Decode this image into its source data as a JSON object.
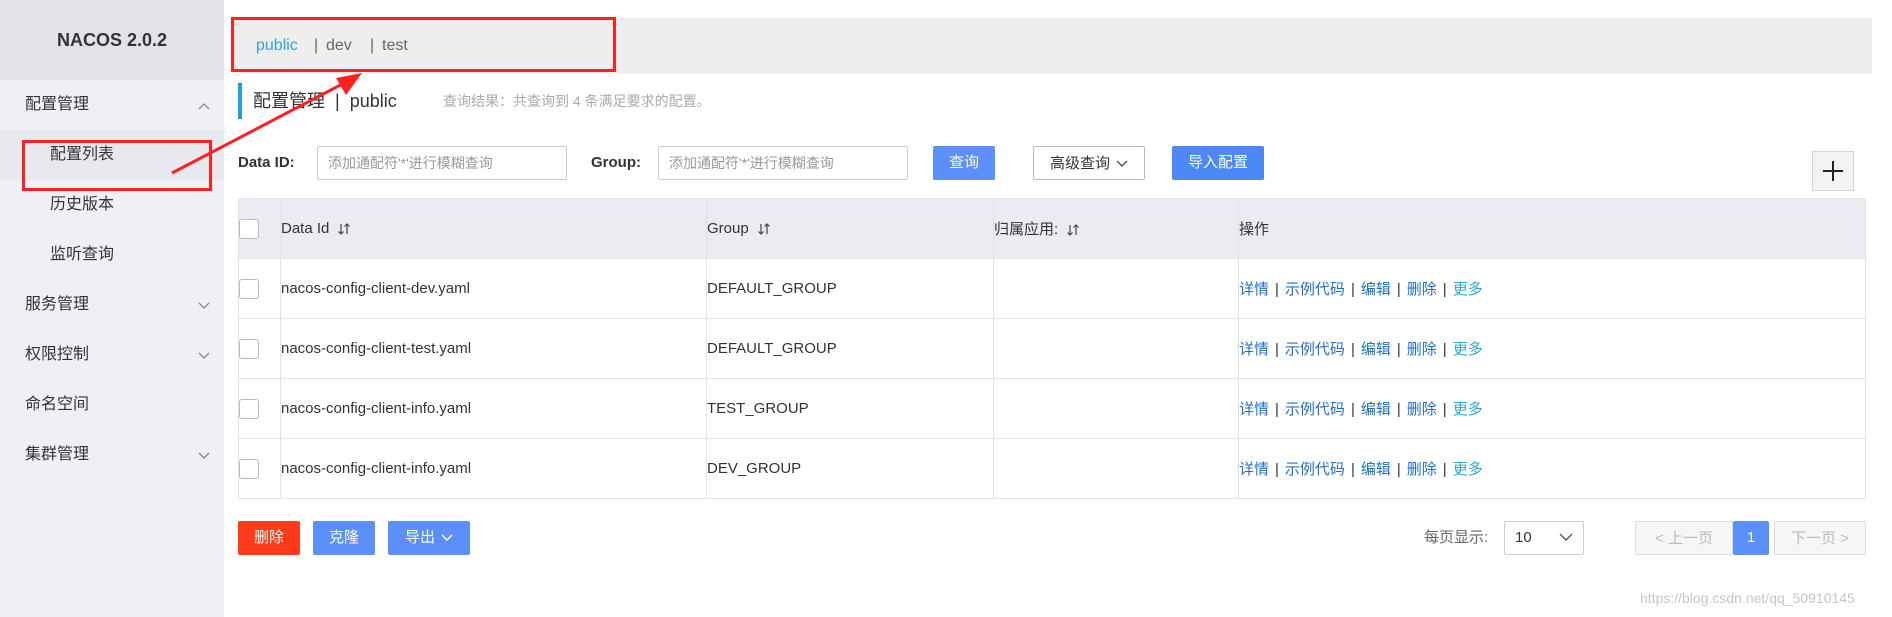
{
  "app": {
    "brand": "NACOS 2.0.2"
  },
  "sidebar": {
    "items": [
      {
        "label": "配置管理",
        "icon": "chevron-up-icon"
      },
      {
        "label": "配置列表"
      },
      {
        "label": "历史版本"
      },
      {
        "label": "监听查询"
      },
      {
        "label": "服务管理",
        "icon": "chevron-down-icon"
      },
      {
        "label": "权限控制",
        "icon": "chevron-down-icon"
      },
      {
        "label": "命名空间"
      },
      {
        "label": "集群管理",
        "icon": "chevron-down-icon"
      }
    ]
  },
  "namespaces": {
    "items": [
      "public",
      "dev",
      "test"
    ],
    "separator": "|"
  },
  "header": {
    "title": "配置管理",
    "separator": "|",
    "namespace": "public",
    "result_text": "查询结果：共查询到 4 条满足要求的配置。"
  },
  "search": {
    "data_id_label": "Data ID:",
    "data_id_placeholder": "添加通配符'*'进行模糊查询",
    "group_label": "Group:",
    "group_placeholder": "添加通配符'*'进行模糊查询",
    "query_label": "查询",
    "advanced_label": "高级查询",
    "import_label": "导入配置",
    "add_icon": "plus-icon"
  },
  "table": {
    "columns": [
      "Data Id",
      "Group",
      "归属应用:",
      "操作"
    ],
    "rows": [
      {
        "data_id": "nacos-config-client-dev.yaml",
        "group": "DEFAULT_GROUP",
        "app": ""
      },
      {
        "data_id": "nacos-config-client-test.yaml",
        "group": "DEFAULT_GROUP",
        "app": ""
      },
      {
        "data_id": "nacos-config-client-info.yaml",
        "group": "TEST_GROUP",
        "app": ""
      },
      {
        "data_id": "nacos-config-client-info.yaml",
        "group": "DEV_GROUP",
        "app": ""
      }
    ],
    "actions": [
      "详情",
      "示例代码",
      "编辑",
      "删除",
      "更多"
    ],
    "action_separator": "|"
  },
  "footer": {
    "delete_label": "删除",
    "clone_label": "克隆",
    "export_label": "导出",
    "page_size_label": "每页显示:",
    "page_size_value": "10",
    "prev_label": "< 上一页",
    "current_page": "1",
    "next_label": "下一页 >"
  },
  "watermark": "https://blog.csdn.net/qq_50910145",
  "colors": {
    "accent": "#5b8ff9",
    "link": "#1f6fd0",
    "namespace_active": "#2aa8d8",
    "danger": "#ff3a1b",
    "annotation": "#ff2020"
  }
}
